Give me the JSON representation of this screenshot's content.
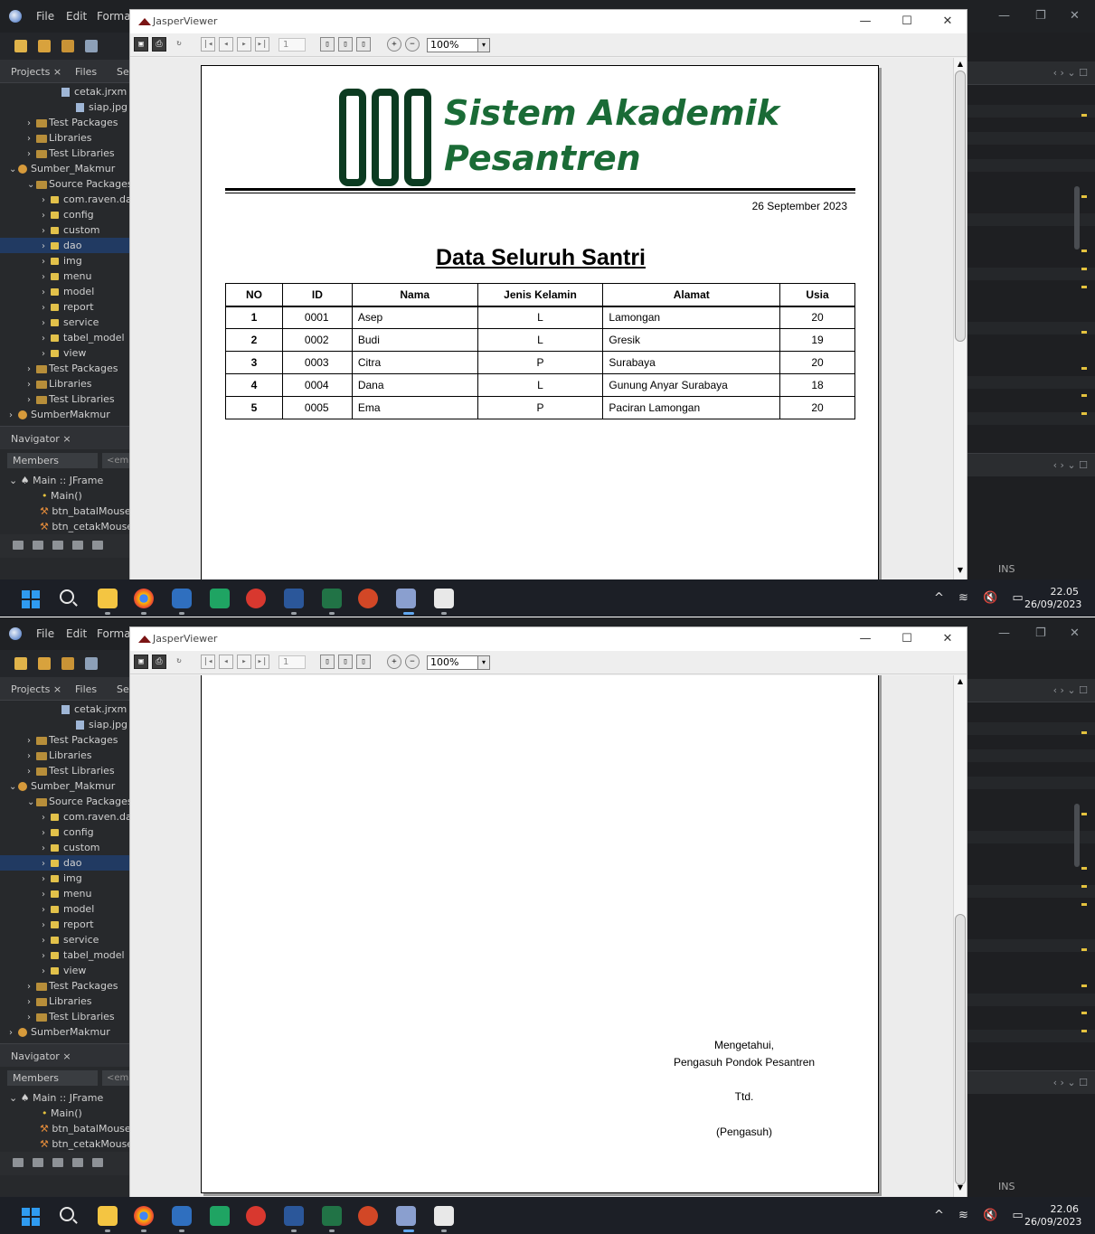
{
  "ide": {
    "menu": [
      "File",
      "Edit",
      "Format"
    ],
    "panel_tabs": [
      "Projects ×",
      "Files",
      "Se"
    ],
    "tree": [
      {
        "label": "cetak.jrxm",
        "kind": "file",
        "indent": 68,
        "chev": ""
      },
      {
        "label": "siap.jpg",
        "kind": "file",
        "indent": 84,
        "chev": ""
      },
      {
        "label": "Test Packages",
        "kind": "lib",
        "indent": 30,
        "chev": "›"
      },
      {
        "label": "Libraries",
        "kind": "lib",
        "indent": 30,
        "chev": "›"
      },
      {
        "label": "Test Libraries",
        "kind": "lib",
        "indent": 30,
        "chev": "›"
      },
      {
        "label": "Sumber_Makmur",
        "kind": "proj",
        "indent": 10,
        "chev": "⌄"
      },
      {
        "label": "Source Packages",
        "kind": "lib",
        "indent": 30,
        "chev": "⌄"
      },
      {
        "label": "com.raven.da",
        "kind": "pkg",
        "indent": 46,
        "chev": "›"
      },
      {
        "label": "config",
        "kind": "pkg",
        "indent": 46,
        "chev": "›"
      },
      {
        "label": "custom",
        "kind": "pkg",
        "indent": 46,
        "chev": "›"
      },
      {
        "label": "dao",
        "kind": "pkg",
        "indent": 46,
        "chev": "›",
        "selected": true
      },
      {
        "label": "img",
        "kind": "pkg",
        "indent": 46,
        "chev": "›"
      },
      {
        "label": "menu",
        "kind": "pkg",
        "indent": 46,
        "chev": "›"
      },
      {
        "label": "model",
        "kind": "pkg",
        "indent": 46,
        "chev": "›"
      },
      {
        "label": "report",
        "kind": "pkg",
        "indent": 46,
        "chev": "›"
      },
      {
        "label": "service",
        "kind": "pkg",
        "indent": 46,
        "chev": "›"
      },
      {
        "label": "tabel_model",
        "kind": "pkg",
        "indent": 46,
        "chev": "›"
      },
      {
        "label": "view",
        "kind": "pkg",
        "indent": 46,
        "chev": "›"
      },
      {
        "label": "Test Packages",
        "kind": "lib",
        "indent": 30,
        "chev": "›"
      },
      {
        "label": "Libraries",
        "kind": "lib",
        "indent": 30,
        "chev": "›"
      },
      {
        "label": "Test Libraries",
        "kind": "lib",
        "indent": 30,
        "chev": "›"
      },
      {
        "label": "SumberMakmur",
        "kind": "proj",
        "indent": 10,
        "chev": "›"
      }
    ],
    "navigator": {
      "title": "Navigator ×",
      "filter": "Members",
      "filter2": "<em",
      "items": [
        "Main :: JFrame",
        "Main()",
        "btn_batalMouseC",
        "btn_cetakMouseC"
      ]
    },
    "status_ins": "INS"
  },
  "viewer": {
    "title": "JasperViewer",
    "page_number": "1",
    "zoom": "100%",
    "zoom_drop": "▾"
  },
  "report": {
    "brand_line1": "Sistem Akademik",
    "brand_line2": "Pesantren",
    "date": "26 September 2023",
    "heading": "Data Seluruh Santri",
    "columns": [
      "NO",
      "ID",
      "Nama",
      "Jenis Kelamin",
      "Alamat",
      "Usia"
    ],
    "rows": [
      [
        "1",
        "0001",
        "Asep",
        "L",
        "Lamongan",
        "20"
      ],
      [
        "2",
        "0002",
        "Budi",
        "L",
        "Gresik",
        "19"
      ],
      [
        "3",
        "0003",
        "Citra",
        "P",
        "Surabaya",
        "20"
      ],
      [
        "4",
        "0004",
        "Dana",
        "L",
        "Gunung Anyar Surabaya",
        "18"
      ],
      [
        "5",
        "0005",
        "Ema",
        "P",
        "Paciran Lamongan",
        "20"
      ]
    ],
    "signature": {
      "line1": "Mengetahui,",
      "line2": "Pengasuh Pondok Pesantren",
      "line3": "Ttd.",
      "line4": "(Pengasuh)"
    }
  },
  "taskbar": {
    "shot1": {
      "time": "22.05",
      "date": "26/09/2023"
    },
    "shot2": {
      "time": "22.06",
      "date": "26/09/2023"
    },
    "tray": "^ ≋ 🔇 ▭"
  }
}
